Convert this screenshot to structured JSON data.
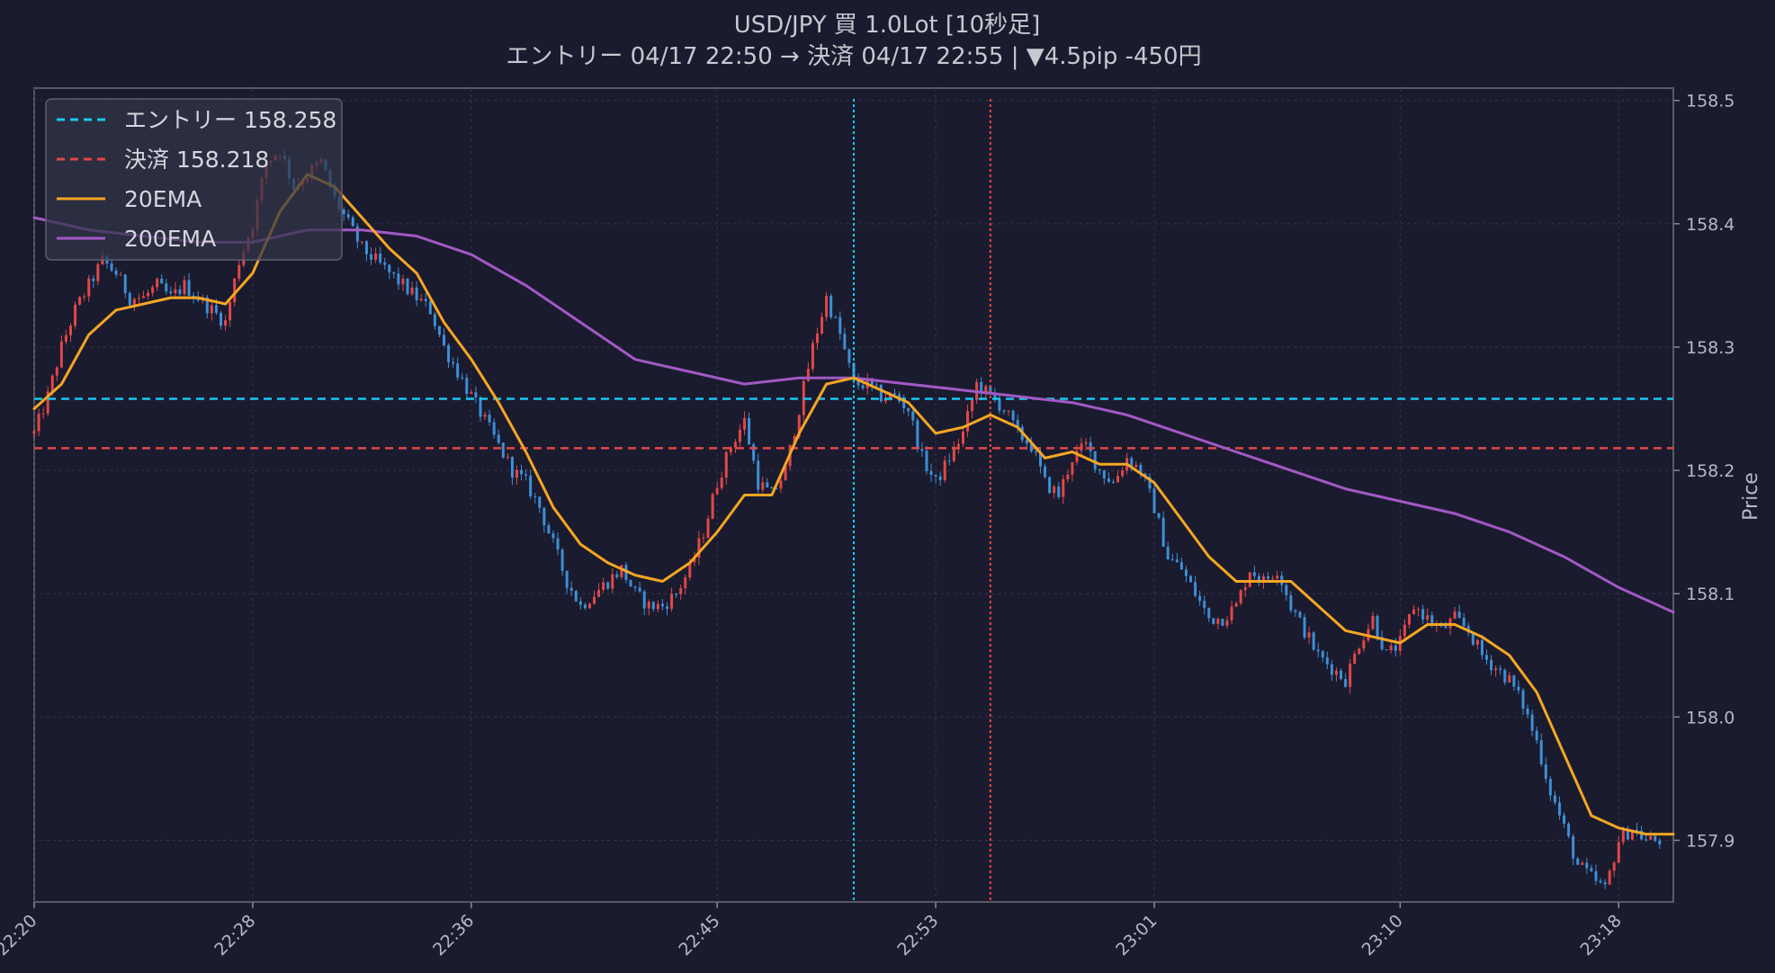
{
  "chart_data": {
    "type": "candlestick",
    "title": "USD/JPY 買 1.0Lot [10秒足]",
    "subtitle": "エントリー 04/17 22:50 → 決済 04/17 22:55 | ▼4.5pip -450円",
    "ylabel": "Price",
    "xlabel": "",
    "x_tick_labels": [
      "22:20",
      "22:28",
      "22:36",
      "22:45",
      "22:53",
      "23:01",
      "23:10",
      "23:18"
    ],
    "y_tick_labels": [
      "157.9",
      "158.0",
      "158.1",
      "158.2",
      "158.3",
      "158.4",
      "158.5"
    ],
    "ylim": [
      157.85,
      158.51
    ],
    "grid": true,
    "legend_position": "top-left",
    "colors": {
      "background": "#1a1b2e",
      "up": "#e04848",
      "down": "#3d8fd6",
      "entry": "#18c8f0",
      "exit": "#e04848",
      "ema20": "#f5a623",
      "ema200": "#a259c4"
    },
    "legend": [
      {
        "label": "エントリー 158.258",
        "style": "dashed",
        "color": "#18c8f0"
      },
      {
        "label": "決済 158.218",
        "style": "dashed",
        "color": "#e04848"
      },
      {
        "label": "20EMA",
        "style": "solid",
        "color": "#f5a623"
      },
      {
        "label": "200EMA",
        "style": "solid",
        "color": "#a259c4"
      }
    ],
    "entry_price": 158.258,
    "exit_price": 158.218,
    "entry_time": "22:50",
    "exit_time": "22:55",
    "time_start": "22:20",
    "time_end": "23:20",
    "price_path": [
      [
        "22:20",
        158.23
      ],
      [
        "22:20:30",
        158.26
      ],
      [
        "22:21",
        158.3
      ],
      [
        "22:21:30",
        158.33
      ],
      [
        "22:22",
        158.35
      ],
      [
        "22:22:30",
        158.37
      ],
      [
        "22:23",
        158.36
      ],
      [
        "22:23:30",
        158.34
      ],
      [
        "22:24",
        158.34
      ],
      [
        "22:24:30",
        158.35
      ],
      [
        "22:25",
        158.34
      ],
      [
        "22:25:30",
        158.35
      ],
      [
        "22:26",
        158.34
      ],
      [
        "22:26:30",
        158.33
      ],
      [
        "22:27",
        158.32
      ],
      [
        "22:27:30",
        158.37
      ],
      [
        "22:28",
        158.4
      ],
      [
        "22:28:30",
        158.45
      ],
      [
        "22:29",
        158.46
      ],
      [
        "22:29:30",
        158.43
      ],
      [
        "22:30",
        158.44
      ],
      [
        "22:30:30",
        158.45
      ],
      [
        "22:31",
        158.42
      ],
      [
        "22:31:30",
        158.4
      ],
      [
        "22:32",
        158.38
      ],
      [
        "22:32:30",
        158.37
      ],
      [
        "22:33",
        158.36
      ],
      [
        "22:33:30",
        158.35
      ],
      [
        "22:34",
        158.34
      ],
      [
        "22:34:30",
        158.33
      ],
      [
        "22:35",
        158.3
      ],
      [
        "22:35:30",
        158.28
      ],
      [
        "22:36",
        158.26
      ],
      [
        "22:36:30",
        158.24
      ],
      [
        "22:37",
        158.22
      ],
      [
        "22:37:30",
        158.2
      ],
      [
        "22:38",
        158.19
      ],
      [
        "22:38:30",
        158.17
      ],
      [
        "22:39",
        158.14
      ],
      [
        "22:39:30",
        158.11
      ],
      [
        "22:40",
        158.09
      ],
      [
        "22:40:30",
        158.1
      ],
      [
        "22:41",
        158.11
      ],
      [
        "22:41:30",
        158.12
      ],
      [
        "22:42",
        158.1
      ],
      [
        "22:42:30",
        158.09
      ],
      [
        "22:43",
        158.09
      ],
      [
        "22:43:30",
        158.1
      ],
      [
        "22:44",
        158.12
      ],
      [
        "22:44:30",
        158.15
      ],
      [
        "22:45",
        158.19
      ],
      [
        "22:45:30",
        158.22
      ],
      [
        "22:46",
        158.24
      ],
      [
        "22:46:30",
        158.19
      ],
      [
        "22:47",
        158.18
      ],
      [
        "22:47:30",
        158.2
      ],
      [
        "22:48",
        158.25
      ],
      [
        "22:48:30",
        158.3
      ],
      [
        "22:49",
        158.34
      ],
      [
        "22:49:30",
        158.31
      ],
      [
        "22:50",
        158.27
      ],
      [
        "22:50:30",
        158.27
      ],
      [
        "22:51",
        158.26
      ],
      [
        "22:51:30",
        158.26
      ],
      [
        "22:52",
        158.25
      ],
      [
        "22:52:30",
        158.21
      ],
      [
        "22:53",
        158.19
      ],
      [
        "22:53:30",
        158.21
      ],
      [
        "22:54",
        158.23
      ],
      [
        "22:54:30",
        158.27
      ],
      [
        "22:55",
        158.26
      ],
      [
        "22:55:30",
        158.25
      ],
      [
        "22:56",
        158.23
      ],
      [
        "22:56:30",
        158.22
      ],
      [
        "22:57",
        158.19
      ],
      [
        "22:57:30",
        158.18
      ],
      [
        "22:58",
        158.21
      ],
      [
        "22:58:30",
        158.22
      ],
      [
        "22:59",
        158.2
      ],
      [
        "22:59:30",
        158.19
      ],
      [
        "23:00",
        158.21
      ],
      [
        "23:00:30",
        158.2
      ],
      [
        "23:01",
        158.17
      ],
      [
        "23:01:30",
        158.13
      ],
      [
        "23:02",
        158.12
      ],
      [
        "23:02:30",
        158.1
      ],
      [
        "23:03",
        158.08
      ],
      [
        "23:03:30",
        158.08
      ],
      [
        "23:04",
        158.09
      ],
      [
        "23:04:30",
        158.12
      ],
      [
        "23:05",
        158.11
      ],
      [
        "23:05:30",
        158.12
      ],
      [
        "23:06",
        158.09
      ],
      [
        "23:06:30",
        158.07
      ],
      [
        "23:07",
        158.05
      ],
      [
        "23:07:30",
        158.04
      ],
      [
        "23:08",
        158.03
      ],
      [
        "23:08:30",
        158.06
      ],
      [
        "23:09",
        158.08
      ],
      [
        "23:09:30",
        158.05
      ],
      [
        "23:10",
        158.06
      ],
      [
        "23:10:30",
        158.09
      ],
      [
        "23:11",
        158.08
      ],
      [
        "23:11:30",
        158.07
      ],
      [
        "23:12",
        158.08
      ],
      [
        "23:12:30",
        158.07
      ],
      [
        "23:13",
        158.05
      ],
      [
        "23:13:30",
        158.04
      ],
      [
        "23:14",
        158.03
      ],
      [
        "23:14:30",
        158.01
      ],
      [
        "23:15",
        157.98
      ],
      [
        "23:15:30",
        157.94
      ],
      [
        "23:16",
        157.91
      ],
      [
        "23:16:30",
        157.88
      ],
      [
        "23:17",
        157.87
      ],
      [
        "23:17:30",
        157.86
      ],
      [
        "23:18",
        157.9
      ],
      [
        "23:18:30",
        157.91
      ],
      [
        "23:19",
        157.9
      ],
      [
        "23:19:30",
        157.9
      ]
    ],
    "ema20": [
      [
        "22:20",
        158.25
      ],
      [
        "22:21",
        158.27
      ],
      [
        "22:22",
        158.31
      ],
      [
        "22:23",
        158.33
      ],
      [
        "22:24",
        158.335
      ],
      [
        "22:25",
        158.34
      ],
      [
        "22:26",
        158.34
      ],
      [
        "22:27",
        158.335
      ],
      [
        "22:28",
        158.36
      ],
      [
        "22:29",
        158.41
      ],
      [
        "22:30",
        158.44
      ],
      [
        "22:31",
        158.43
      ],
      [
        "22:32",
        158.405
      ],
      [
        "22:33",
        158.38
      ],
      [
        "22:34",
        158.36
      ],
      [
        "22:35",
        158.32
      ],
      [
        "22:36",
        158.29
      ],
      [
        "22:37",
        158.255
      ],
      [
        "22:38",
        158.215
      ],
      [
        "22:39",
        158.17
      ],
      [
        "22:40",
        158.14
      ],
      [
        "22:41",
        158.125
      ],
      [
        "22:42",
        158.115
      ],
      [
        "22:43",
        158.11
      ],
      [
        "22:44",
        158.125
      ],
      [
        "22:45",
        158.15
      ],
      [
        "22:46",
        158.18
      ],
      [
        "22:47",
        158.18
      ],
      [
        "22:48",
        158.23
      ],
      [
        "22:49",
        158.27
      ],
      [
        "22:50",
        158.275
      ],
      [
        "22:51",
        158.265
      ],
      [
        "22:52",
        158.255
      ],
      [
        "22:53",
        158.23
      ],
      [
        "22:54",
        158.235
      ],
      [
        "22:55",
        158.245
      ],
      [
        "22:56",
        158.235
      ],
      [
        "22:57",
        158.21
      ],
      [
        "22:58",
        158.215
      ],
      [
        "22:59",
        158.205
      ],
      [
        "23:00",
        158.205
      ],
      [
        "23:01",
        158.19
      ],
      [
        "23:02",
        158.16
      ],
      [
        "23:03",
        158.13
      ],
      [
        "23:04",
        158.11
      ],
      [
        "23:05",
        158.11
      ],
      [
        "23:06",
        158.11
      ],
      [
        "23:07",
        158.09
      ],
      [
        "23:08",
        158.07
      ],
      [
        "23:09",
        158.065
      ],
      [
        "23:10",
        158.06
      ],
      [
        "23:11",
        158.075
      ],
      [
        "23:12",
        158.075
      ],
      [
        "23:13",
        158.065
      ],
      [
        "23:14",
        158.05
      ],
      [
        "23:15",
        158.02
      ],
      [
        "23:16",
        157.97
      ],
      [
        "23:17",
        157.92
      ],
      [
        "23:18",
        157.91
      ],
      [
        "23:19",
        157.905
      ],
      [
        "23:20",
        157.905
      ]
    ],
    "ema200": [
      [
        "22:20",
        158.405
      ],
      [
        "22:22",
        158.395
      ],
      [
        "22:24",
        158.39
      ],
      [
        "22:26",
        158.385
      ],
      [
        "22:28",
        158.385
      ],
      [
        "22:30",
        158.395
      ],
      [
        "22:32",
        158.395
      ],
      [
        "22:34",
        158.39
      ],
      [
        "22:36",
        158.375
      ],
      [
        "22:38",
        158.35
      ],
      [
        "22:40",
        158.32
      ],
      [
        "22:42",
        158.29
      ],
      [
        "22:44",
        158.28
      ],
      [
        "22:46",
        158.27
      ],
      [
        "22:48",
        158.275
      ],
      [
        "22:50",
        158.275
      ],
      [
        "22:52",
        158.27
      ],
      [
        "22:54",
        158.265
      ],
      [
        "22:56",
        158.26
      ],
      [
        "22:58",
        158.255
      ],
      [
        "23:00",
        158.245
      ],
      [
        "23:02",
        158.23
      ],
      [
        "23:04",
        158.215
      ],
      [
        "23:06",
        158.2
      ],
      [
        "23:08",
        158.185
      ],
      [
        "23:10",
        158.175
      ],
      [
        "23:12",
        158.165
      ],
      [
        "23:14",
        158.15
      ],
      [
        "23:16",
        158.13
      ],
      [
        "23:18",
        158.105
      ],
      [
        "23:20",
        158.085
      ]
    ]
  }
}
